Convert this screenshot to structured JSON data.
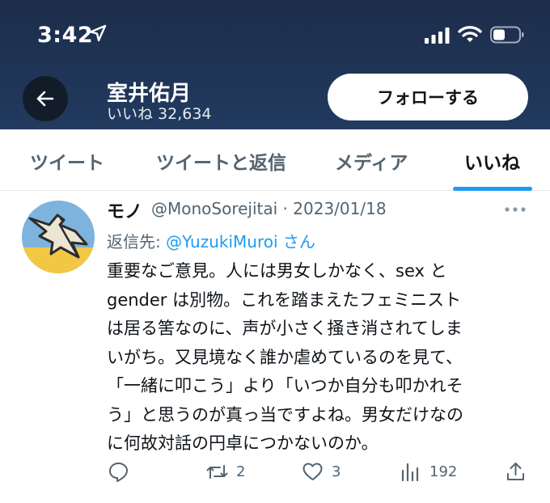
{
  "status_bar": {
    "time": "3:42",
    "icons": [
      "location-arrow-icon",
      "signal-icon",
      "wifi-icon",
      "battery-icon"
    ]
  },
  "header": {
    "name": "室井佑月",
    "subtitle": "いいね 32,634",
    "follow_label": "フォローする",
    "back_icon": "arrow-left-icon"
  },
  "tabs": [
    {
      "label": "ツイート",
      "active": false
    },
    {
      "label": "ツイートと返信",
      "active": false
    },
    {
      "label": "メディア",
      "active": false
    },
    {
      "label": "いいね",
      "active": true
    }
  ],
  "tweet": {
    "display_name": "モノ",
    "meta": "@MonoSorejitai · 2023/01/18",
    "reply_prefix": "返信先: ",
    "reply_mention": "@YuzukiMuroi",
    "reply_suffix": " さん",
    "body_lines": [
      "重要なご意見。人には男女しかなく、sex と",
      "gender は別物。これを踏まえたフェミニスト",
      "は居る筈なのに、声が小さく掻き消されてしま",
      "いがち。又見境なく誰か虐めているのを見て、",
      "「一緒に叩こう」より「いつか自分も叩かれそ",
      "う」と思うのが真っ当ですよね。男女だけなの",
      "に何故対話の円卓につかないのか。"
    ],
    "actions": {
      "reply_count": "",
      "retweet_count": "2",
      "like_count": "3",
      "views_count": "192"
    }
  },
  "colors": {
    "header_bg": "#1f3456",
    "accent": "#1d9bf0",
    "muted": "#536471"
  }
}
